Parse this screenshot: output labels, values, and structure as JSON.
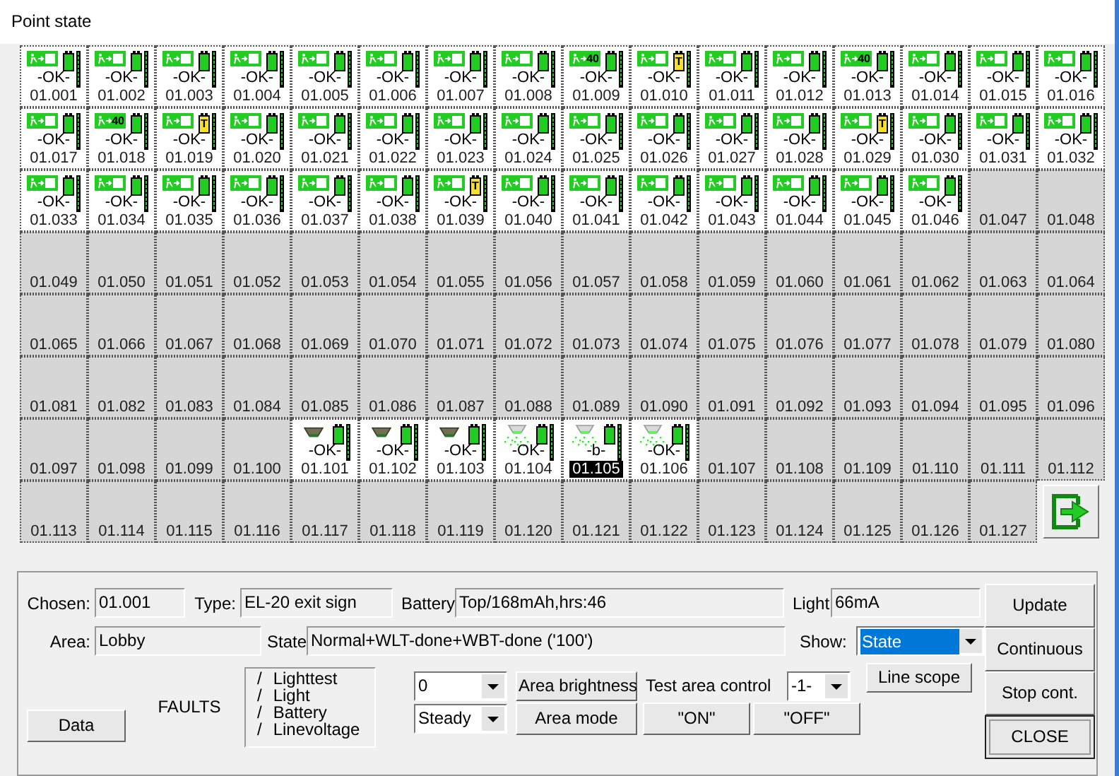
{
  "window": {
    "title": "Point state"
  },
  "cells": [
    {
      "label": "01.001",
      "kind": "exit",
      "status": "-OK-",
      "selected": false
    },
    {
      "label": "01.002",
      "kind": "exit",
      "status": "-OK-",
      "selected": false
    },
    {
      "label": "01.003",
      "kind": "exit",
      "status": "-OK-",
      "selected": false
    },
    {
      "label": "01.004",
      "kind": "exit",
      "status": "-OK-",
      "selected": false
    },
    {
      "label": "01.005",
      "kind": "exit",
      "status": "-OK-",
      "selected": false
    },
    {
      "label": "01.006",
      "kind": "exit",
      "status": "-OK-",
      "selected": false
    },
    {
      "label": "01.007",
      "kind": "exit",
      "status": "-OK-",
      "selected": false
    },
    {
      "label": "01.008",
      "kind": "exit",
      "status": "-OK-",
      "selected": false
    },
    {
      "label": "01.009",
      "kind": "exit",
      "status": "-OK-",
      "selected": false,
      "sign_text": "40"
    },
    {
      "label": "01.010",
      "kind": "exit",
      "status": "-OK-",
      "selected": false,
      "battery_text": "T"
    },
    {
      "label": "01.011",
      "kind": "exit",
      "status": "-OK-",
      "selected": false
    },
    {
      "label": "01.012",
      "kind": "exit",
      "status": "-OK-",
      "selected": false
    },
    {
      "label": "01.013",
      "kind": "exit",
      "status": "-OK-",
      "selected": false,
      "sign_text": "40"
    },
    {
      "label": "01.014",
      "kind": "exit",
      "status": "-OK-",
      "selected": false
    },
    {
      "label": "01.015",
      "kind": "exit",
      "status": "-OK-",
      "selected": false
    },
    {
      "label": "01.016",
      "kind": "exit",
      "status": "-OK-",
      "selected": false
    },
    {
      "label": "01.017",
      "kind": "exit",
      "status": "-OK-",
      "selected": false
    },
    {
      "label": "01.018",
      "kind": "exit",
      "status": "-OK-",
      "selected": false,
      "sign_text": "40"
    },
    {
      "label": "01.019",
      "kind": "exit",
      "status": "-OK-",
      "selected": false,
      "battery_text": "T"
    },
    {
      "label": "01.020",
      "kind": "exit",
      "status": "-OK-",
      "selected": false
    },
    {
      "label": "01.021",
      "kind": "exit",
      "status": "-OK-",
      "selected": false
    },
    {
      "label": "01.022",
      "kind": "exit",
      "status": "-OK-",
      "selected": false
    },
    {
      "label": "01.023",
      "kind": "exit",
      "status": "-OK-",
      "selected": false
    },
    {
      "label": "01.024",
      "kind": "exit",
      "status": "-OK-",
      "selected": false
    },
    {
      "label": "01.025",
      "kind": "exit",
      "status": "-OK-",
      "selected": false
    },
    {
      "label": "01.026",
      "kind": "exit",
      "status": "-OK-",
      "selected": false
    },
    {
      "label": "01.027",
      "kind": "exit",
      "status": "-OK-",
      "selected": false
    },
    {
      "label": "01.028",
      "kind": "exit",
      "status": "-OK-",
      "selected": false
    },
    {
      "label": "01.029",
      "kind": "exit",
      "status": "-OK-",
      "selected": false,
      "battery_text": "T"
    },
    {
      "label": "01.030",
      "kind": "exit",
      "status": "-OK-",
      "selected": false
    },
    {
      "label": "01.031",
      "kind": "exit",
      "status": "-OK-",
      "selected": false
    },
    {
      "label": "01.032",
      "kind": "exit",
      "status": "-OK-",
      "selected": false
    },
    {
      "label": "01.033",
      "kind": "exit",
      "status": "-OK-",
      "selected": false
    },
    {
      "label": "01.034",
      "kind": "exit",
      "status": "-OK-",
      "selected": false
    },
    {
      "label": "01.035",
      "kind": "exit",
      "status": "-OK-",
      "selected": false
    },
    {
      "label": "01.036",
      "kind": "exit",
      "status": "-OK-",
      "selected": false
    },
    {
      "label": "01.037",
      "kind": "exit",
      "status": "-OK-",
      "selected": false
    },
    {
      "label": "01.038",
      "kind": "exit",
      "status": "-OK-",
      "selected": false
    },
    {
      "label": "01.039",
      "kind": "exit",
      "status": "-OK-",
      "selected": false,
      "battery_text": "T"
    },
    {
      "label": "01.040",
      "kind": "exit",
      "status": "-OK-",
      "selected": false
    },
    {
      "label": "01.041",
      "kind": "exit",
      "status": "-OK-",
      "selected": false
    },
    {
      "label": "01.042",
      "kind": "exit",
      "status": "-OK-",
      "selected": false
    },
    {
      "label": "01.043",
      "kind": "exit",
      "status": "-OK-",
      "selected": false
    },
    {
      "label": "01.044",
      "kind": "exit",
      "status": "-OK-",
      "selected": false
    },
    {
      "label": "01.045",
      "kind": "exit",
      "status": "-OK-",
      "selected": false
    },
    {
      "label": "01.046",
      "kind": "exit",
      "status": "-OK-",
      "selected": false
    },
    {
      "label": "01.047",
      "kind": "empty",
      "selected": false
    },
    {
      "label": "01.048",
      "kind": "empty",
      "selected": false
    },
    {
      "label": "01.049",
      "kind": "empty",
      "selected": false
    },
    {
      "label": "01.050",
      "kind": "empty",
      "selected": false
    },
    {
      "label": "01.051",
      "kind": "empty",
      "selected": false
    },
    {
      "label": "01.052",
      "kind": "empty",
      "selected": false
    },
    {
      "label": "01.053",
      "kind": "empty",
      "selected": false
    },
    {
      "label": "01.054",
      "kind": "empty",
      "selected": false
    },
    {
      "label": "01.055",
      "kind": "empty",
      "selected": false
    },
    {
      "label": "01.056",
      "kind": "empty",
      "selected": false
    },
    {
      "label": "01.057",
      "kind": "empty",
      "selected": false
    },
    {
      "label": "01.058",
      "kind": "empty",
      "selected": false
    },
    {
      "label": "01.059",
      "kind": "empty",
      "selected": false
    },
    {
      "label": "01.060",
      "kind": "empty",
      "selected": false
    },
    {
      "label": "01.061",
      "kind": "empty",
      "selected": false
    },
    {
      "label": "01.062",
      "kind": "empty",
      "selected": false
    },
    {
      "label": "01.063",
      "kind": "empty",
      "selected": false
    },
    {
      "label": "01.064",
      "kind": "empty",
      "selected": false
    },
    {
      "label": "01.065",
      "kind": "empty",
      "selected": false
    },
    {
      "label": "01.066",
      "kind": "empty",
      "selected": false
    },
    {
      "label": "01.067",
      "kind": "empty",
      "selected": false
    },
    {
      "label": "01.068",
      "kind": "empty",
      "selected": false
    },
    {
      "label": "01.069",
      "kind": "empty",
      "selected": false
    },
    {
      "label": "01.070",
      "kind": "empty",
      "selected": false
    },
    {
      "label": "01.071",
      "kind": "empty",
      "selected": false
    },
    {
      "label": "01.072",
      "kind": "empty",
      "selected": false
    },
    {
      "label": "01.073",
      "kind": "empty",
      "selected": false
    },
    {
      "label": "01.074",
      "kind": "empty",
      "selected": false
    },
    {
      "label": "01.075",
      "kind": "empty",
      "selected": false
    },
    {
      "label": "01.076",
      "kind": "empty",
      "selected": false
    },
    {
      "label": "01.077",
      "kind": "empty",
      "selected": false
    },
    {
      "label": "01.078",
      "kind": "empty",
      "selected": false
    },
    {
      "label": "01.079",
      "kind": "empty",
      "selected": false
    },
    {
      "label": "01.080",
      "kind": "empty",
      "selected": false
    },
    {
      "label": "01.081",
      "kind": "empty",
      "selected": false
    },
    {
      "label": "01.082",
      "kind": "empty",
      "selected": false
    },
    {
      "label": "01.083",
      "kind": "empty",
      "selected": false
    },
    {
      "label": "01.084",
      "kind": "empty",
      "selected": false
    },
    {
      "label": "01.085",
      "kind": "empty",
      "selected": false
    },
    {
      "label": "01.086",
      "kind": "empty",
      "selected": false
    },
    {
      "label": "01.087",
      "kind": "empty",
      "selected": false
    },
    {
      "label": "01.088",
      "kind": "empty",
      "selected": false
    },
    {
      "label": "01.089",
      "kind": "empty",
      "selected": false
    },
    {
      "label": "01.090",
      "kind": "empty",
      "selected": false
    },
    {
      "label": "01.091",
      "kind": "empty",
      "selected": false
    },
    {
      "label": "01.092",
      "kind": "empty",
      "selected": false
    },
    {
      "label": "01.093",
      "kind": "empty",
      "selected": false
    },
    {
      "label": "01.094",
      "kind": "empty",
      "selected": false
    },
    {
      "label": "01.095",
      "kind": "empty",
      "selected": false
    },
    {
      "label": "01.096",
      "kind": "empty",
      "selected": false
    },
    {
      "label": "01.097",
      "kind": "empty",
      "selected": false
    },
    {
      "label": "01.098",
      "kind": "empty",
      "selected": false
    },
    {
      "label": "01.099",
      "kind": "empty",
      "selected": false
    },
    {
      "label": "01.100",
      "kind": "empty",
      "selected": false
    },
    {
      "label": "01.101",
      "kind": "downlight",
      "status": "-OK-",
      "lit": false,
      "selected": false
    },
    {
      "label": "01.102",
      "kind": "downlight",
      "status": "-OK-",
      "lit": false,
      "selected": false
    },
    {
      "label": "01.103",
      "kind": "downlight",
      "status": "-OK-",
      "lit": false,
      "selected": false
    },
    {
      "label": "01.104",
      "kind": "downlight",
      "status": "-OK-",
      "lit": true,
      "selected": false
    },
    {
      "label": "01.105",
      "kind": "downlight",
      "status": "-b-",
      "lit": true,
      "selected": true
    },
    {
      "label": "01.106",
      "kind": "downlight",
      "status": "-OK-",
      "lit": true,
      "selected": false
    },
    {
      "label": "01.107",
      "kind": "empty",
      "selected": false
    },
    {
      "label": "01.108",
      "kind": "empty",
      "selected": false
    },
    {
      "label": "01.109",
      "kind": "empty",
      "selected": false
    },
    {
      "label": "01.110",
      "kind": "empty",
      "selected": false
    },
    {
      "label": "01.111",
      "kind": "empty",
      "selected": false
    },
    {
      "label": "01.112",
      "kind": "empty",
      "selected": false
    },
    {
      "label": "01.113",
      "kind": "empty",
      "selected": false
    },
    {
      "label": "01.114",
      "kind": "empty",
      "selected": false
    },
    {
      "label": "01.115",
      "kind": "empty",
      "selected": false
    },
    {
      "label": "01.116",
      "kind": "empty",
      "selected": false
    },
    {
      "label": "01.117",
      "kind": "empty",
      "selected": false
    },
    {
      "label": "01.118",
      "kind": "empty",
      "selected": false
    },
    {
      "label": "01.119",
      "kind": "empty",
      "selected": false
    },
    {
      "label": "01.120",
      "kind": "empty",
      "selected": false
    },
    {
      "label": "01.121",
      "kind": "empty",
      "selected": false
    },
    {
      "label": "01.122",
      "kind": "empty",
      "selected": false
    },
    {
      "label": "01.123",
      "kind": "empty",
      "selected": false
    },
    {
      "label": "01.124",
      "kind": "empty",
      "selected": false
    },
    {
      "label": "01.125",
      "kind": "empty",
      "selected": false
    },
    {
      "label": "01.126",
      "kind": "empty",
      "selected": false
    },
    {
      "label": "01.127",
      "kind": "empty",
      "selected": false
    }
  ],
  "details": {
    "chosen": {
      "label": "Chosen:",
      "value": "01.001"
    },
    "type": {
      "label": "Type:",
      "value": "EL-20 exit sign"
    },
    "battery": {
      "label": "Battery",
      "value": "Top/168mAh,hrs:46"
    },
    "light": {
      "label": "Light",
      "value": "66mA"
    },
    "area": {
      "label": "Area:",
      "value": "Lobby"
    },
    "state": {
      "label": "State",
      "value": "Normal+WLT-done+WBT-done ('100')"
    },
    "show": {
      "label": "Show:",
      "value": "State"
    }
  },
  "data_button": "Data",
  "faults": {
    "label": "FAULTS",
    "items": [
      {
        "mark": "/",
        "label": "Lighttest"
      },
      {
        "mark": "/",
        "label": "Light"
      },
      {
        "mark": "/",
        "label": "Battery"
      },
      {
        "mark": "/",
        "label": "Linevoltage"
      }
    ]
  },
  "brightness_select": "0",
  "mode_select": "Steady",
  "area_brightness_button": "Area brightness",
  "area_mode_button": "Area mode",
  "test_area": {
    "label": "Test area control",
    "select": "-1-",
    "on_button": "\"ON\"",
    "off_button": "\"OFF\""
  },
  "line_scope_button": "Line scope",
  "side_buttons": [
    {
      "label": "Update",
      "default": false
    },
    {
      "label": "Continuous",
      "default": false
    },
    {
      "label": "Stop cont.",
      "default": false
    },
    {
      "label": "CLOSE",
      "default": true
    }
  ]
}
